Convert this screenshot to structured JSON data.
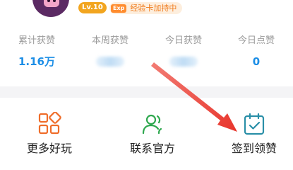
{
  "profile": {
    "level": "Lv.10",
    "exp_tag": "Exp",
    "exp_status": "经验卡加持中"
  },
  "stats": [
    {
      "label": "累计获赞",
      "value": "1.16万"
    },
    {
      "label": "本周获赞",
      "value": ""
    },
    {
      "label": "今日获赞",
      "value": ""
    },
    {
      "label": "今日点赞",
      "value": "0"
    }
  ],
  "actions": [
    {
      "label": "更多好玩",
      "icon": "grid-icon"
    },
    {
      "label": "联系官方",
      "icon": "contact-person-icon"
    },
    {
      "label": "签到领赞",
      "icon": "calendar-check-icon"
    }
  ],
  "colors": {
    "accent_blue": "#1c8ee6",
    "icon_orange": "#ef6d2a",
    "icon_green": "#2fa84f",
    "icon_teal": "#2a8fa8",
    "arrow_red": "#e8352c",
    "level_badge": "#f2a51f"
  }
}
